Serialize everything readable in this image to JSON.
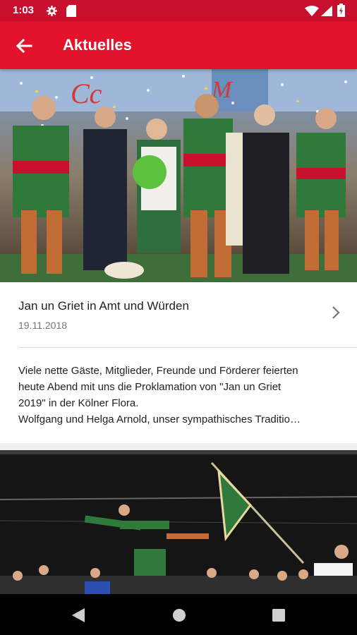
{
  "status_bar": {
    "time": "1:03",
    "icons": [
      "gear-icon",
      "sd-card-icon",
      "wifi-icon",
      "signal-icon",
      "battery-icon"
    ]
  },
  "app_bar": {
    "title": "Aktuelles",
    "back_icon": "arrow-left-icon"
  },
  "news": [
    {
      "title": "Jan un Griet in Amt und Würden",
      "date": "19.11.2018",
      "teaser_lines": [
        "Viele nette Gäste, Mitglieder, Freunde und Förderer feierten",
        "heute Abend mit uns die Proklamation von \"Jan un Griet",
        "2019\" in der Kölner Flora.",
        "Wolfgang und Helga Arnold, unser sympathisches Traditio…"
      ]
    }
  ],
  "colors": {
    "status_bar": "#c8102e",
    "app_bar": "#e3132b",
    "background": "#f0f0f0"
  },
  "nav_bar": {
    "icons": [
      "back-triangle-icon",
      "home-circle-icon",
      "recents-square-icon"
    ]
  }
}
